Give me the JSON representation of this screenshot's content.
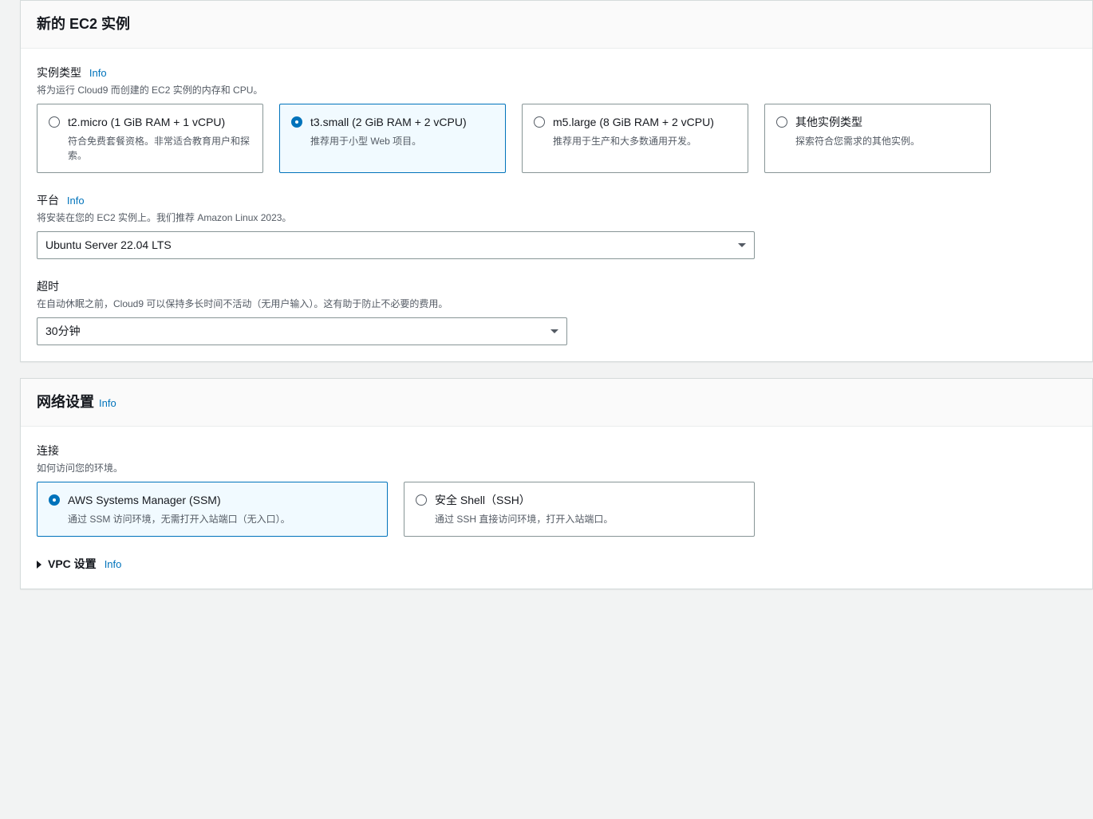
{
  "info_label": "Info",
  "ec2_panel": {
    "title": "新的 EC2 实例",
    "instance_type": {
      "label": "实例类型",
      "desc": "将为运行 Cloud9 而创建的 EC2 实例的内存和 CPU。",
      "options": [
        {
          "title": "t2.micro (1 GiB RAM + 1 vCPU)",
          "desc": "符合免费套餐资格。非常适合教育用户和探索。",
          "selected": false
        },
        {
          "title": "t3.small (2 GiB RAM + 2 vCPU)",
          "desc": "推荐用于小型 Web 项目。",
          "selected": true
        },
        {
          "title": "m5.large (8 GiB RAM + 2 vCPU)",
          "desc": "推荐用于生产和大多数通用开发。",
          "selected": false
        },
        {
          "title": "其他实例类型",
          "desc": "探索符合您需求的其他实例。",
          "selected": false
        }
      ]
    },
    "platform": {
      "label": "平台",
      "desc": "将安装在您的 EC2 实例上。我们推荐 Amazon Linux 2023。",
      "value": "Ubuntu Server 22.04 LTS"
    },
    "timeout": {
      "label": "超时",
      "desc": "在自动休眠之前，Cloud9 可以保持多长时间不活动（无用户输入）。这有助于防止不必要的费用。",
      "value": "30分钟"
    }
  },
  "network_panel": {
    "title": "网络设置",
    "connection": {
      "label": "连接",
      "desc": "如何访问您的环境。",
      "options": [
        {
          "title": "AWS Systems Manager (SSM)",
          "desc": "通过 SSM 访问环境，无需打开入站端口（无入口）。",
          "selected": true
        },
        {
          "title": "安全 Shell（SSH）",
          "desc": "通过 SSH 直接访问环境，打开入站端口。",
          "selected": false
        }
      ]
    },
    "vpc": {
      "label": "VPC 设置"
    }
  }
}
